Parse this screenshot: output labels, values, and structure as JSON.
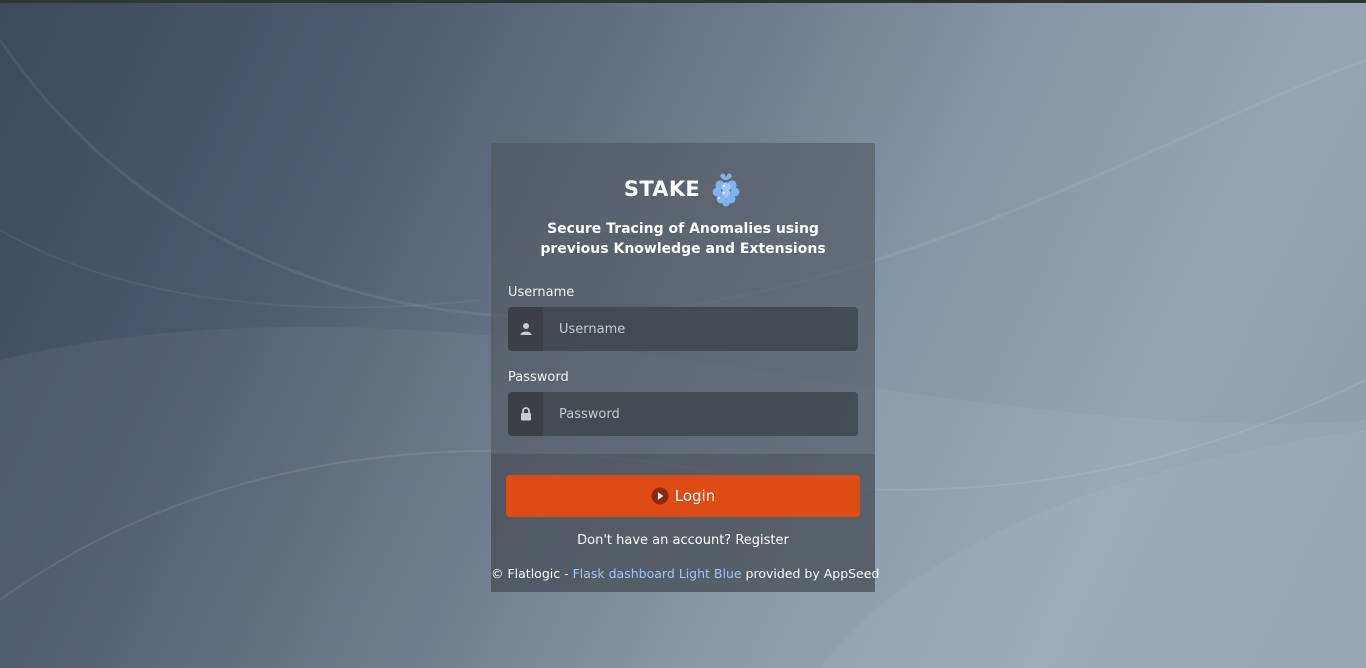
{
  "brand": {
    "name": "STAKE",
    "subtitle": "Secure Tracing of Anomalies using previous Knowledge and Extensions",
    "logo_icon": "raspberry-icon"
  },
  "form": {
    "username": {
      "label": "Username",
      "placeholder": "Username",
      "value": "",
      "icon": "user-icon"
    },
    "password": {
      "label": "Password",
      "placeholder": "Password",
      "value": "",
      "icon": "lock-icon"
    },
    "login_button": {
      "label": "Login",
      "icon": "play-circle-icon"
    }
  },
  "register": {
    "prompt": "Don't have an account?",
    "link_label": "Register"
  },
  "footer": {
    "copyright": "© Flatlogic -",
    "link_text": "Flask dashboard Light Blue",
    "suffix": "provided by AppSeed"
  },
  "colors": {
    "accent": "#dc4c13",
    "link": "#9fc6f5",
    "logo": "#7fb4f0"
  }
}
